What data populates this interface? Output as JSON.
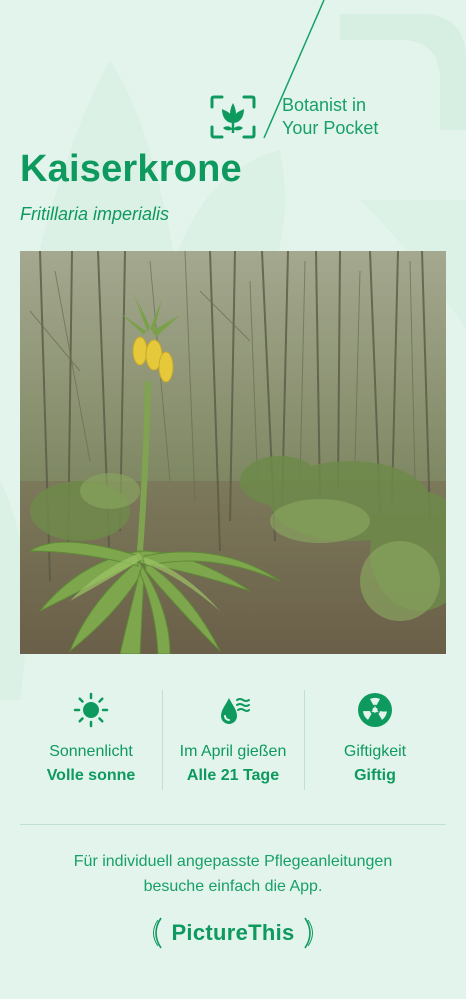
{
  "brand": {
    "tagline_line1": "Botanist in",
    "tagline_line2": "Your Pocket",
    "logo_icon": "plant-scan-icon",
    "footer_name": "PictureThis"
  },
  "plant": {
    "common_name": "Kaiserkrone",
    "scientific_name": "Fritillaria imperialis"
  },
  "stats": [
    {
      "icon": "sun-icon",
      "label": "Sonnenlicht",
      "value": "Volle sonne"
    },
    {
      "icon": "water-drop-icon",
      "label": "Im April gießen",
      "value": "Alle 21 Tage"
    },
    {
      "icon": "toxicity-icon",
      "label": "Giftigkeit",
      "value": "Giftig"
    }
  ],
  "cta": {
    "line1": "Für individuell angepasste Pflegeanleitungen",
    "line2": "besuche einfach die App."
  },
  "colors": {
    "background": "#e3f4ec",
    "accent": "#0e9a5e"
  }
}
